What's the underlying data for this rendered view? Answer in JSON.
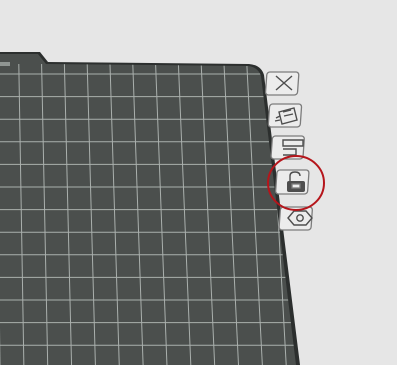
{
  "viewport": {
    "plate": {
      "surface_color": "#4b4f4d",
      "gridline_color": "#aab0ad",
      "rim_color": "#2c2f2e",
      "highlight_color": "#5d6260"
    },
    "side_toolbar": {
      "buttons": [
        {
          "name": "close-button",
          "icon": "close-icon"
        },
        {
          "name": "arrange-objects-button",
          "icon": "arrange-icon"
        },
        {
          "name": "orient-button",
          "icon": "layers-icon"
        },
        {
          "name": "lock-plate-button",
          "icon": "unlock-icon",
          "highlighted": true
        },
        {
          "name": "plate-settings-button",
          "icon": "hex-settings-icon"
        }
      ]
    },
    "annotation": {
      "highlight_color": "#b5151b",
      "target": "lock-plate-button"
    }
  }
}
